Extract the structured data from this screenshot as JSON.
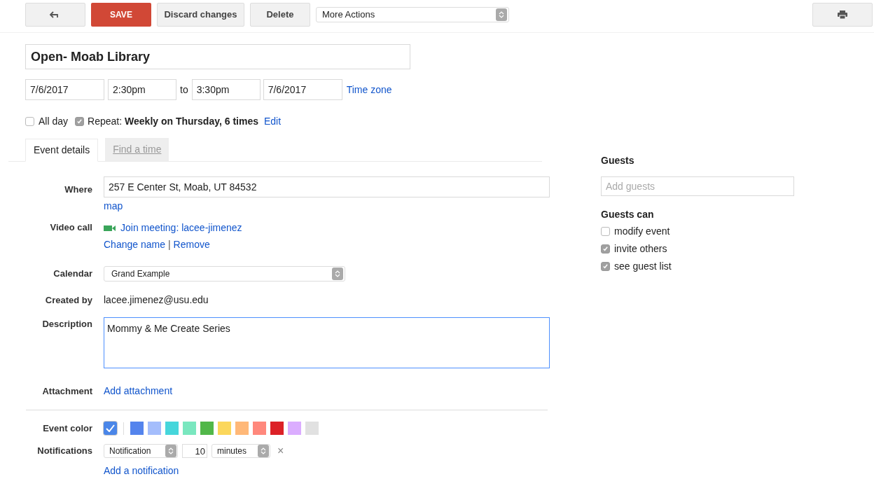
{
  "toolbar": {
    "save": "SAVE",
    "discard": "Discard changes",
    "delete": "Delete",
    "more_actions": "More Actions"
  },
  "title": "Open- Moab Library",
  "when": {
    "start_date": "7/6/2017",
    "start_time": "2:30pm",
    "to": "to",
    "end_time": "3:30pm",
    "end_date": "7/6/2017",
    "time_zone": "Time zone"
  },
  "all_day": {
    "label": "All day",
    "checked": false
  },
  "repeat": {
    "label": "Repeat:",
    "summary": "Weekly on Thursday, 6 times",
    "checked": true,
    "edit": "Edit"
  },
  "tabs": [
    {
      "label": "Event details",
      "selected": true
    },
    {
      "label": "Find a time",
      "selected": false
    }
  ],
  "where": {
    "label": "Where",
    "value": "257 E Center St, Moab, UT 84532",
    "map": "map"
  },
  "video_call": {
    "label": "Video call",
    "join": "Join meeting: lacee-jimenez",
    "change_name": "Change name",
    "separator": "|",
    "remove": "Remove"
  },
  "calendar": {
    "label": "Calendar",
    "value": "Grand Example"
  },
  "created_by": {
    "label": "Created by",
    "value": "lacee.jimenez@usu.edu"
  },
  "description": {
    "label": "Description",
    "value": "Mommy & Me Create Series"
  },
  "attachment": {
    "label": "Attachment",
    "link": "Add attachment"
  },
  "event_color": {
    "label": "Event color",
    "colors": [
      {
        "color": "#4a86e8",
        "selected": true
      },
      {
        "color": "#5484ed",
        "selected": false
      },
      {
        "color": "#a4bdfc",
        "selected": false
      },
      {
        "color": "#46d6db",
        "selected": false
      },
      {
        "color": "#7ae7bf",
        "selected": false
      },
      {
        "color": "#51b749",
        "selected": false
      },
      {
        "color": "#fbd75b",
        "selected": false
      },
      {
        "color": "#ffb878",
        "selected": false
      },
      {
        "color": "#ff887c",
        "selected": false
      },
      {
        "color": "#dc2127",
        "selected": false
      },
      {
        "color": "#dbadff",
        "selected": false
      },
      {
        "color": "#e1e1e1",
        "selected": false
      }
    ]
  },
  "notifications": {
    "label": "Notifications",
    "type": "Notification",
    "amount": "10",
    "unit": "minutes",
    "remove": "×",
    "add": "Add a notification"
  },
  "guests": {
    "title": "Guests",
    "placeholder": "Add guests",
    "can_title": "Guests can",
    "permissions": [
      {
        "label": "modify event",
        "checked": false
      },
      {
        "label": "invite others",
        "checked": true
      },
      {
        "label": "see guest list",
        "checked": true
      }
    ]
  }
}
